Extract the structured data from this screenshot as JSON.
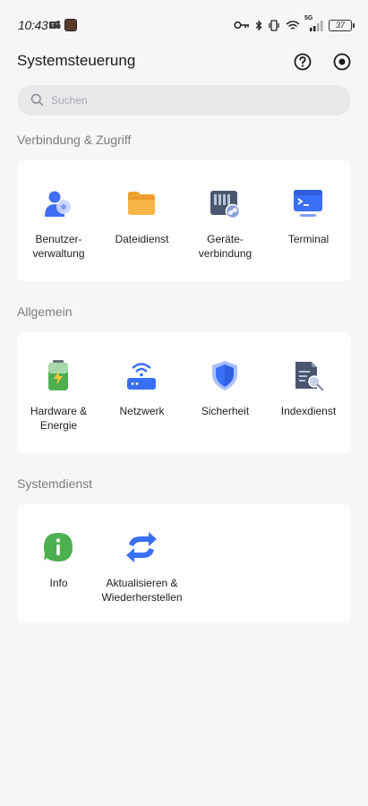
{
  "status_bar": {
    "time": "10:43",
    "network": "5G",
    "battery": "37"
  },
  "header": {
    "title": "Systemsteuerung"
  },
  "search": {
    "placeholder": "Suchen"
  },
  "sections": [
    {
      "title": "Verbindung & Zugriff",
      "items": [
        {
          "label": "Benutzer-\nverwaltung",
          "icon": "users-icon"
        },
        {
          "label": "Dateidienst",
          "icon": "folder-icon"
        },
        {
          "label": "Geräte-\nverbindung",
          "icon": "device-link-icon"
        },
        {
          "label": "Terminal",
          "icon": "terminal-icon"
        }
      ]
    },
    {
      "title": "Allgemein",
      "items": [
        {
          "label": "Hardware &\nEnergie",
          "icon": "battery-icon"
        },
        {
          "label": "Netzwerk",
          "icon": "router-icon"
        },
        {
          "label": "Sicherheit",
          "icon": "shield-icon"
        },
        {
          "label": "Indexdienst",
          "icon": "index-search-icon"
        }
      ]
    },
    {
      "title": "Systemdienst",
      "items": [
        {
          "label": "Info",
          "icon": "info-icon"
        },
        {
          "label": "Aktualisieren &\nWiederherstellen",
          "icon": "update-arrows-icon"
        }
      ]
    }
  ],
  "colors": {
    "background": "#f6f6f7",
    "card": "#ffffff",
    "accent_blue": "#3a6ff7",
    "section_title": "#7c7c80"
  }
}
